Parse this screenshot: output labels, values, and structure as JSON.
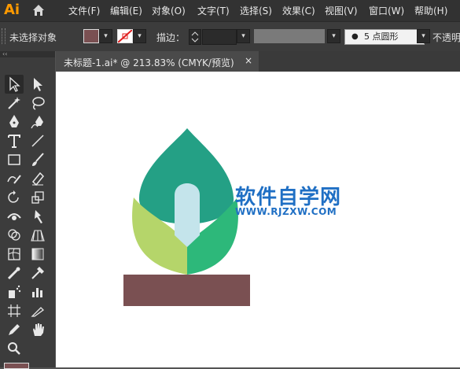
{
  "app": {
    "logo": "Ai"
  },
  "menu": [
    "文件(F)",
    "编辑(E)",
    "对象(O)",
    "文字(T)",
    "选择(S)",
    "效果(C)",
    "视图(V)",
    "窗口(W)",
    "帮助(H)"
  ],
  "control": {
    "selection_status": "未选择对象",
    "stroke_label": "描边：",
    "brush_value": "5 点圆形",
    "opacity_label": "不透明",
    "fill_color": "#7a5052"
  },
  "document": {
    "tab_title": "未标题-1.ai* @ 213.83% (CMYK/预览)",
    "close_glyph": "×"
  },
  "artwork": {
    "leaf_top_color": "#24a085",
    "leaf_left_color": "#b5d56a",
    "leaf_right_color": "#2db87a",
    "stem_color": "#c4e4eb",
    "pot_color": "#7a5052"
  },
  "watermark": {
    "title": "软件自学网",
    "url": "WWW.RJZXW.COM"
  },
  "panel": {
    "collapse_glyph": "‹‹"
  }
}
